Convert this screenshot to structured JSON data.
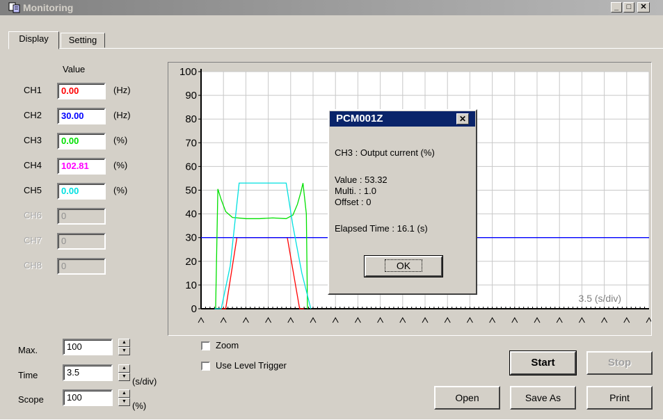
{
  "window": {
    "title": "Monitoring"
  },
  "tabs": [
    {
      "label": "Display",
      "active": true
    },
    {
      "label": "Setting",
      "active": false
    }
  ],
  "value_header": "Value",
  "channels": [
    {
      "name": "CH1",
      "value": "0.00",
      "unit": "(Hz)",
      "color": "#ff0000",
      "enabled": true
    },
    {
      "name": "CH2",
      "value": "30.00",
      "unit": "(Hz)",
      "color": "#0000ff",
      "enabled": true
    },
    {
      "name": "CH3",
      "value": "0.00",
      "unit": "(%)",
      "color": "#00e000",
      "enabled": true
    },
    {
      "name": "CH4",
      "value": "102.81",
      "unit": "(%)",
      "color": "#ff00ff",
      "enabled": true
    },
    {
      "name": "CH5",
      "value": "0.00",
      "unit": "(%)",
      "color": "#00e0e0",
      "enabled": true
    },
    {
      "name": "CH6",
      "value": "0",
      "unit": "",
      "color": "#909090",
      "enabled": false
    },
    {
      "name": "CH7",
      "value": "0",
      "unit": "",
      "color": "#909090",
      "enabled": false
    },
    {
      "name": "CH8",
      "value": "0",
      "unit": "",
      "color": "#909090",
      "enabled": false
    }
  ],
  "controls": {
    "max_label": "Max.",
    "max_value": "100",
    "time_label": "Time",
    "time_value": "3.5",
    "time_unit": "(s/div)",
    "scope_label": "Scope",
    "scope_value": "100",
    "scope_unit": "(%)",
    "zoom_label": "Zoom",
    "zoom_checked": false,
    "trigger_label": "Use Level Trigger",
    "trigger_checked": false
  },
  "buttons": {
    "start": "Start",
    "stop": "Stop",
    "open": "Open",
    "save_as": "Save As",
    "print": "Print"
  },
  "chart_data": {
    "type": "line",
    "ylim": [
      0,
      100
    ],
    "yticks": [
      "0",
      "10",
      "20",
      "30",
      "40",
      "50",
      "60",
      "70",
      "80",
      "90",
      "100"
    ],
    "time_div_label": "3.5 (s/div)",
    "x_divisions": 20,
    "series": [
      {
        "color": "#ff0000",
        "x": [
          0.9,
          1.1,
          1.6,
          1.85,
          3.6,
          3.85,
          4.4,
          4.6
        ],
        "y": [
          0,
          0,
          30,
          30,
          30,
          30,
          0,
          0
        ]
      },
      {
        "color": "#0000ff",
        "x": [
          0,
          0.9,
          4.6,
          20
        ],
        "y": [
          30,
          30,
          30,
          30
        ]
      },
      {
        "color": "#00e000",
        "x": [
          0.65,
          0.75,
          0.8,
          0.9,
          1.1,
          1.4,
          2.0,
          2.6,
          3.2,
          3.8,
          4.1,
          4.3,
          4.45,
          4.55,
          4.7,
          4.75
        ],
        "y": [
          0,
          50.5,
          49,
          46,
          41,
          38.5,
          38,
          38,
          38.3,
          38,
          39.5,
          44,
          49,
          53,
          40,
          0
        ]
      },
      {
        "color": "#00e0e0",
        "x": [
          0.6,
          0.9,
          1.3,
          1.7,
          2.5,
          3.6,
          3.8,
          4.1,
          4.5,
          4.9
        ],
        "y": [
          0,
          0,
          18,
          53,
          53,
          53,
          53,
          35,
          15,
          0
        ]
      }
    ]
  },
  "popup": {
    "title": "PCM001Z",
    "channel_line": "CH3 : Output current (%)",
    "value_line": "Value : 53.32",
    "multi_line": "Multi. : 1.0",
    "offset_line": "Offset : 0",
    "elapsed_line": "Elapsed Time : 16.1 (s)",
    "ok_label": "OK"
  }
}
